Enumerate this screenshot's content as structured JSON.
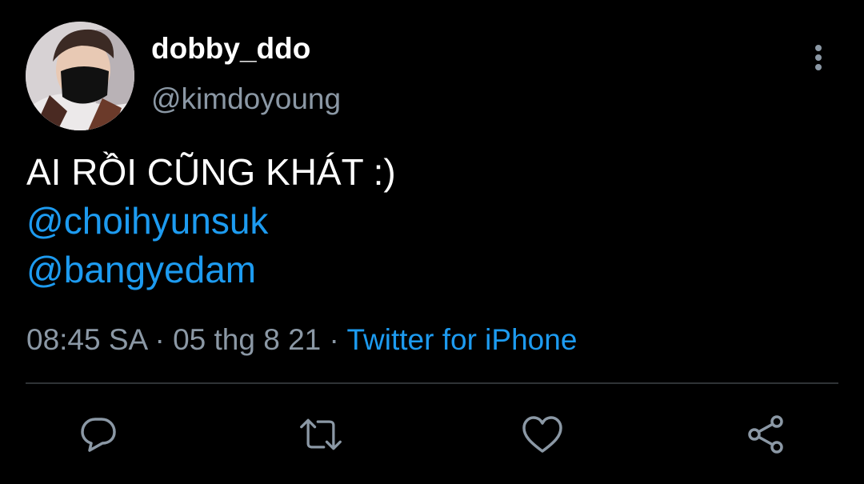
{
  "tweet": {
    "author": {
      "display_name": "dobby_ddo",
      "handle": "@kimdoyoung"
    },
    "text_line": "AI RỒI CŨNG KHÁT :)",
    "mentions": [
      "@choihyunsuk",
      "@bangyedam"
    ],
    "time": "08:45 SA",
    "date": "05 thg 8 21",
    "separator": "·",
    "source": "Twitter for iPhone"
  },
  "actions": [
    "reply-icon",
    "retweet-icon",
    "like-icon",
    "share-icon"
  ],
  "colors": {
    "background": "#000000",
    "primary_text": "#ffffff",
    "secondary_text": "#8b98a5",
    "accent": "#1d9bf0",
    "divider": "#2f3336"
  }
}
